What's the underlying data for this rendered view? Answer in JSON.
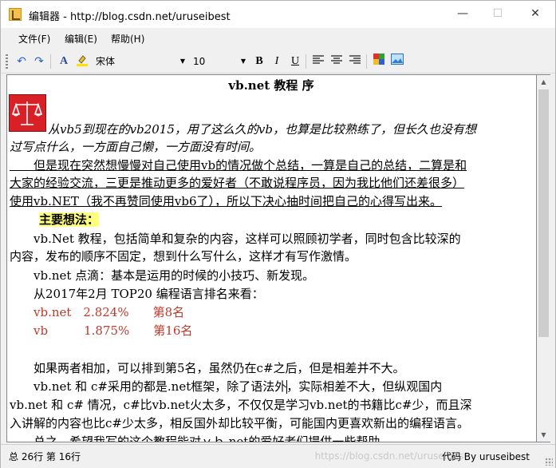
{
  "window": {
    "title": "编辑器 - http://blog.csdn.net/uruseibest",
    "controls": {
      "minimize": "—",
      "maximize": "☐",
      "close": "✕"
    }
  },
  "menu": [
    "文件(F)",
    "编辑(E)",
    "帮助(H)"
  ],
  "toolbar": {
    "font_name": "宋体",
    "font_size": "10",
    "bold": "B",
    "italic": "I",
    "underline": "U",
    "font_color_glyph": "A"
  },
  "document": {
    "title": "vb.net 教程 序",
    "p1_line1": "从vb5到现在的vb2015，用了这么久的vb，也算是比较熟练了，但长久也没有想",
    "p1_line2": "过写点什么，一方面自己懒，一方面没有时间。",
    "p2_line1": "　　但是现在突然想慢慢对自己使用vb的情况做个总结，一算是自己的总结，二算是和",
    "p2_line2": "大家的经验交流，三更是推动更多的爱好者（不敢说程序员，因为我比他们还差很多）",
    "p2_line3": "使用vb.NET（我不再赞同使用vb6了），所以下决心抽时间把自己的心得写出来。",
    "heading_main": "主要想法：",
    "p3_line1": "　　vb.Net 教程，包括简单和复杂的内容，这样可以照顾初学者，同时包含比较深的",
    "p3_line2": "内容，发布的顺序不固定，想到什么写什么，这样才有写作激情。",
    "p4": "　　vb.net 点滴：基本是运用的时候的小技巧、新发现。",
    "p5": "　　从2017年2月 TOP20 编程语言排名来看：",
    "rank1": "　　vb.net　2.824%　　第8名",
    "rank2": "　　vb　　　1.875%　　第16名",
    "p6": "　　如果两者相加，可以排到第5名，虽然仍在c#之后，但是相差并不大。",
    "p7_line1": "　　vb.net 和 c#采用的都是.net框架，除了语法外，实际相差不大，但纵观国内",
    "p7_line2": "vb.net 和 c# 情况，c#比vb.net火太多，不仅仅是学习vb.net的书籍比c#少，而且深",
    "p7_line3": "入讲解的内容也比c#少太多，相反国外却比较平衡，可能国内更喜欢新出的编程语言。",
    "p8_partial": "　　总之，希望我写的这个教程能对ｖｂ.net的爱好者们提供一些帮助。"
  },
  "status": {
    "left": "总 26行 第 16行",
    "right": "代码 By uruseibest",
    "watermark": "https://blog.csdn.net/uruseibest"
  },
  "colors": {
    "red_text": "#c0392b",
    "highlight": "#ffff80"
  }
}
